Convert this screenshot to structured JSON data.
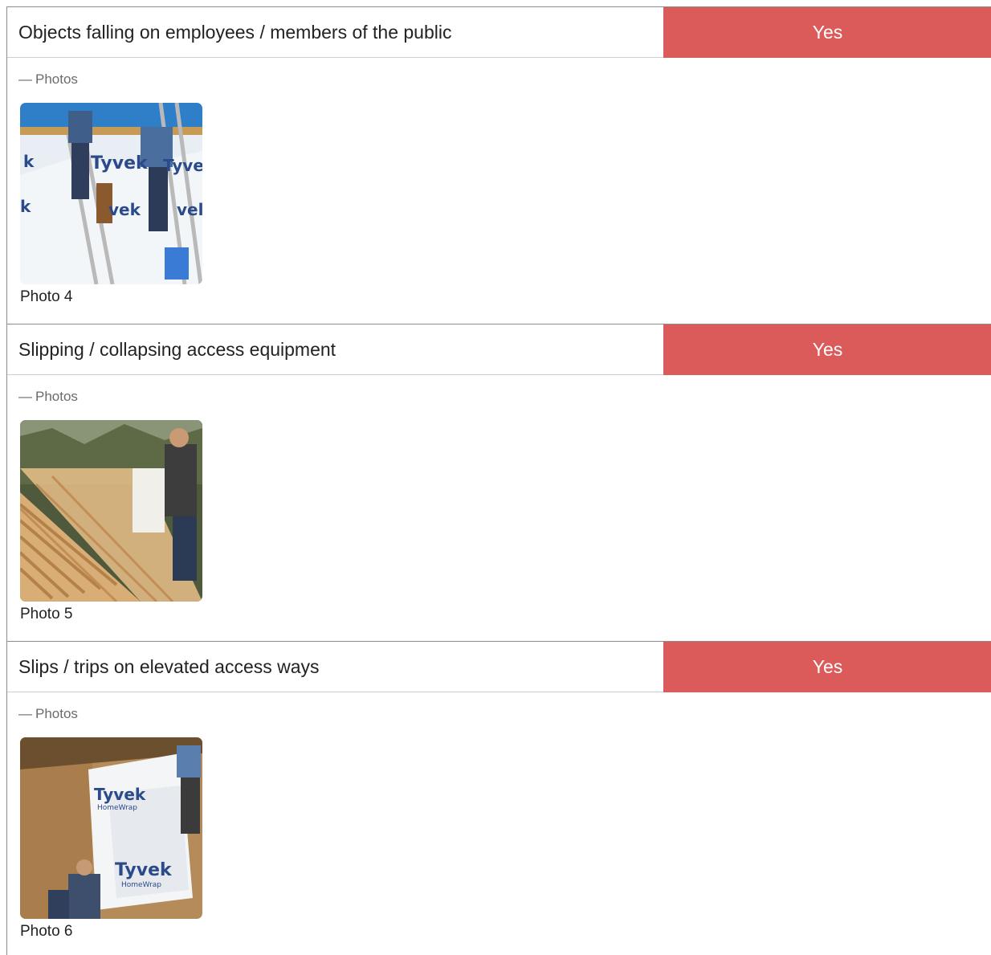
{
  "items": [
    {
      "question": "Objects falling on employees / members of the public",
      "answer": "Yes",
      "photos_label": "Photos",
      "photo_caption": "Photo 4",
      "photo_desc": "workers-ladders-tyvek"
    },
    {
      "question": "Slipping / collapsing access equipment",
      "answer": "Yes",
      "photos_label": "Photos",
      "photo_caption": "Photo 5",
      "photo_desc": "workers-roof-trusses"
    },
    {
      "question": "Slips / trips on elevated access ways",
      "answer": "Yes",
      "photos_label": "Photos",
      "photo_caption": "Photo 6",
      "photo_desc": "workers-tyvek-wall"
    }
  ],
  "colors": {
    "answer_yes": "#db5a5a",
    "divider": "#8c8c8c",
    "muted_text": "#6b6b6b"
  },
  "icons": {
    "collapse": "minus-icon"
  },
  "photo_logos": {
    "p4": [
      "Tyvek",
      "Tyvek",
      "vek",
      "vel",
      "k",
      "k"
    ],
    "p6": [
      "Tyvek",
      "Tyvek",
      "HomeWrap",
      "HomeWrap"
    ]
  }
}
